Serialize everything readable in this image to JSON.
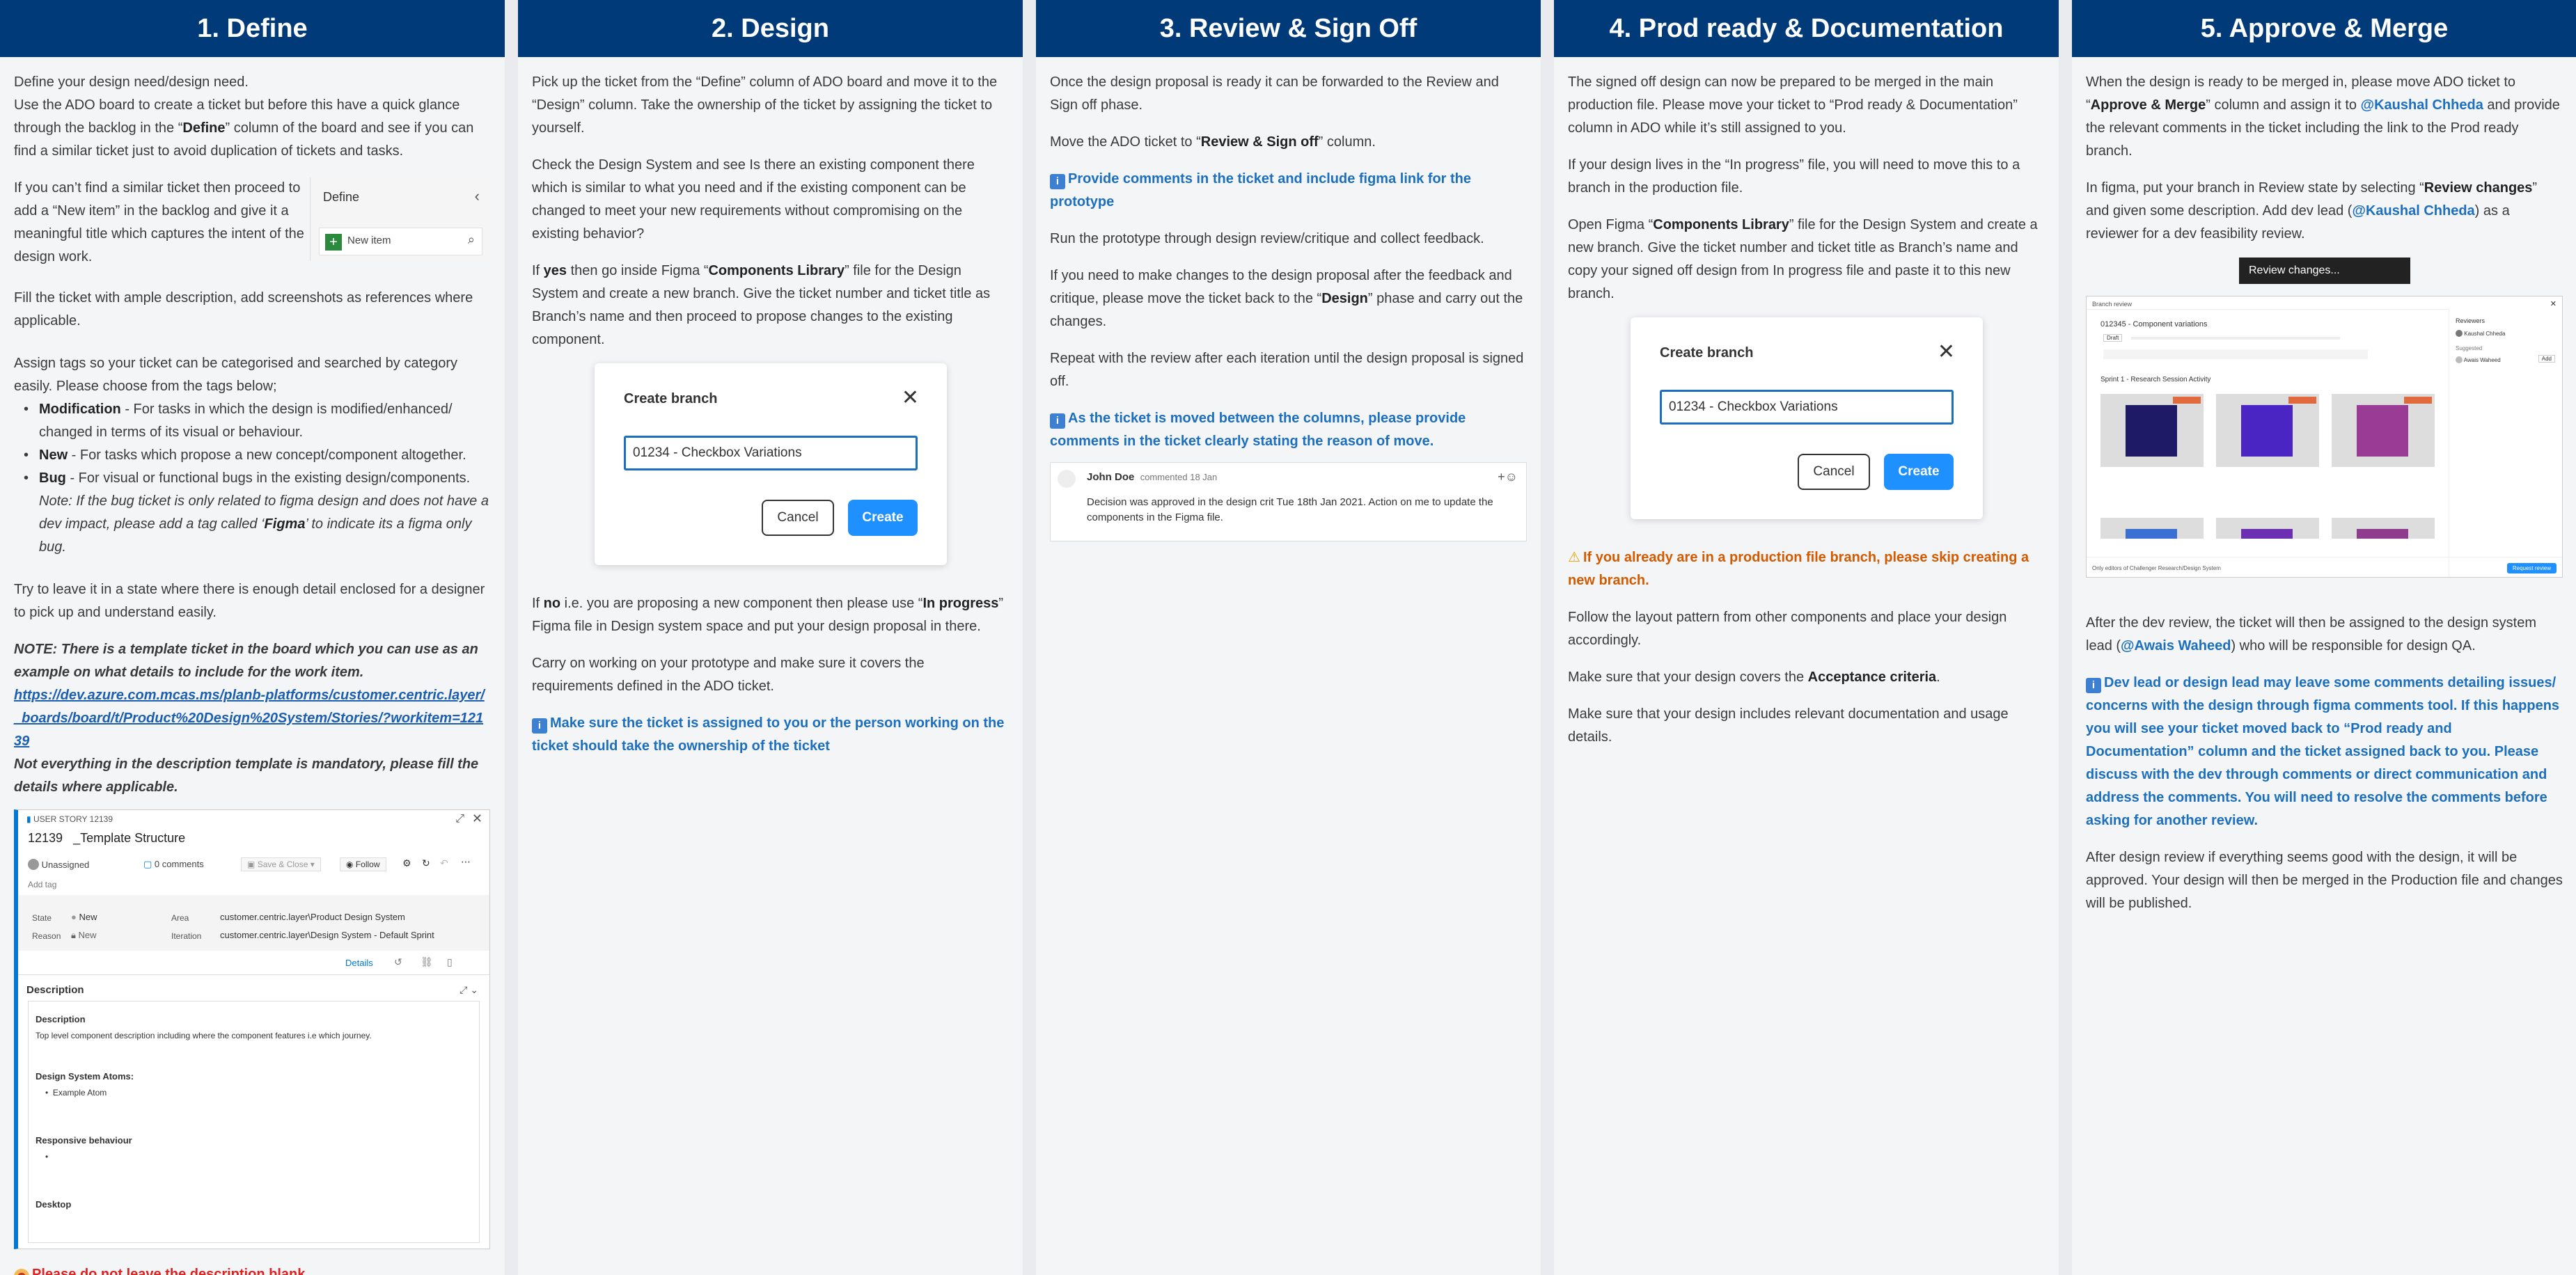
{
  "columns": [
    {
      "title": "1. Define"
    },
    {
      "title": "2. Design"
    },
    {
      "title": "3. Review & Sign Off"
    },
    {
      "title": "4. Prod ready & Documentation"
    },
    {
      "title": "5. Approve & Merge"
    }
  ],
  "define": {
    "p1": "Define your design need/design need.",
    "p2a": "Use the ADO board to create a ticket but before this have a quick glance through the backlog in the “",
    "p2b": "Define",
    "p2c": "” column of the board and see if you can find a similar ticket just to avoid duplication of tickets and tasks.",
    "p3": "If you can’t find a similar ticket then proceed to add a “New item” in the backlog and give it a meaningful title which captures the intent of the design work.",
    "panel_title": "Define",
    "panel_new_item": "New item",
    "p4": "Fill the ticket with ample description, add screenshots as references where applicable.",
    "p5": "Assign tags so your ticket can be categorised and searched by category easily. Please choose from the tags below;",
    "tag1_name": "Modification",
    "tag1_desc": " - For tasks in which the design is modified/enhanced/ changed in terms of its visual or behaviour.",
    "tag2_name": "New",
    "tag2_desc": " - For tasks which propose a new concept/component altogether.",
    "tag3_name": "Bug",
    "tag3_desc": " - For visual or functional bugs in the existing design/components.",
    "bug_note_a": "Note: If the bug ticket is only related to figma design and does not have a dev impact, please add a tag called ‘",
    "bug_note_b": "Figma",
    "bug_note_c": "’ to indicate its a figma only bug.",
    "p6": "Try to leave it in a state where there is enough detail enclosed for a designer to pick up and understand easily.",
    "note": "NOTE: There is a template ticket in the board which you can use as an example on what details to include for the work item.",
    "link": "https://dev.azure.com.mcas.ms/planb-platforms/customer.centric.layer/_boards/board/t/Product%20Design%20System/Stories/?workitem=12139",
    "note2": "Not everything in the description template is mandatory, please fill the details where applicable.",
    "warning": "Please do not leave the description blank."
  },
  "story": {
    "type_label": "USER STORY 12139",
    "id": "12139",
    "title": "_Template Structure",
    "assignee": "Unassigned",
    "comments": "0 comments",
    "save_close": "Save & Close",
    "follow": "Follow",
    "add_tag": "Add tag",
    "state_label": "State",
    "state_value": "New",
    "reason_label": "Reason",
    "reason_value": "New",
    "area_label": "Area",
    "area_value": "customer.centric.layer\\Product Design System",
    "iteration_label": "Iteration",
    "iteration_value": "customer.centric.layer\\Design System - Default Sprint",
    "details_tab": "Details",
    "desc_heading": "Description",
    "d_sub1": "Description",
    "d_text1": "Top level component description including where the component features i.e which journey.",
    "d_sub2": "Design System Atoms:",
    "d_item2": "Example Atom",
    "d_sub3": "Responsive behaviour",
    "d_sub4": "Desktop"
  },
  "design": {
    "p1": "Pick up the ticket from the “Define” column of ADO board and move it to the “Design” column. Take the ownership of the ticket by assigning the ticket to yourself.",
    "p2": "Check the Design System and see Is there an existing component there which is similar to what you need and if the existing component can be changed to meet your new requirements without compromising on the existing behavior?",
    "p3a": "If ",
    "p3b": "yes",
    "p3c": " then go inside Figma “",
    "p3d": "Components Library",
    "p3e": "” file for the Design System and create a new branch. Give the ticket number and ticket title as Branch’s name and then proceed to propose changes to the existing component.",
    "p4a": "If ",
    "p4b": "no",
    "p4c": " i.e. you are proposing a new component then please use “",
    "p4d": "In progress",
    "p4e": "” Figma file in Design system space and put your design proposal in there.",
    "p5": "Carry on working on your prototype and make sure it covers the requirements defined in the ADO ticket.",
    "callout": "Make sure the ticket is assigned to you or the person working on the ticket should take the ownership of the ticket"
  },
  "dialog": {
    "title": "Create branch",
    "input_value": "01234 - Checkbox Variations",
    "cancel": "Cancel",
    "create": "Create"
  },
  "review": {
    "p1": "Once the design proposal is ready it can be forwarded to the Review and Sign off phase.",
    "p2a": "Move the ADO ticket to “",
    "p2b": "Review & Sign off",
    "p2c": "” column.",
    "callout1": "Provide comments in the ticket and include figma link for the prototype",
    "p3": "Run the prototype through design review/critique and collect feedback.",
    "p4a": "If you need to make changes to the design proposal after the feedback and critique, please move the ticket back to the “",
    "p4b": "Design",
    "p4c": "” phase and carry out the changes.",
    "p5": "Repeat with the review after each iteration until the design proposal is signed off.",
    "callout2": "As the ticket is moved between the columns, please provide comments in the ticket clearly stating the reason of move.",
    "comment_author": "John Doe",
    "comment_meta": "commented 18 Jan",
    "comment_text": "Decision was approved in the design crit Tue 18th Jan 2021. Action on me to update the components in the Figma file."
  },
  "prod": {
    "p1": "The signed off design can now be prepared to be merged in the main production file. Please move your ticket to “Prod ready & Documentation” column in ADO while it’s still assigned to you.",
    "p2": "If your design lives in the “In progress” file, you will need to move this to a branch in the production file.",
    "p3a": "Open Figma “",
    "p3b": "Components Library",
    "p3c": "” file for the Design System and create a new branch. Give the ticket number and ticket title as Branch’s name and copy your signed off design from In progress file and paste it to this new branch.",
    "warning": "If you already are in a production file branch, please skip creating a new branch.",
    "p4": "Follow the layout pattern from other components and place your design accordingly.",
    "p5a": "Make sure that your design covers the ",
    "p5b": "Acceptance criteria",
    "p5c": ".",
    "p6": "Make sure that your design includes relevant documentation and usage details."
  },
  "merge": {
    "p1a": "When the design is ready to be merged in, please move ADO ticket to “",
    "p1b": "Approve & Merge",
    "p1c": "” column and assign it to ",
    "p1d": "@Kaushal Chheda",
    "p1e": " and provide the relevant comments in the ticket including the link to the Prod ready branch.",
    "p2a": "In figma, put your branch in Review state by selecting “",
    "p2b": "Review changes",
    "p2c": "” and given some description. Add dev lead (",
    "p2d": "@Kaushal Chheda",
    "p2e": ") as a reviewer for a dev feasibility review.",
    "review_btn": "Review changes...",
    "br_header": "Branch review",
    "br_title": "012345 - Component variations",
    "br_draft": "Draft",
    "br_sprint": "Sprint 1 - Research Session Activity",
    "br_reviewers": "Reviewers",
    "br_r1": "Kaushal Chheda",
    "br_suggested": "Suggested",
    "br_r2": "Awais Waheed",
    "br_add": "Add",
    "br_footer": "Only editors of Challenger Research/Design System",
    "br_request": "Request review",
    "p3a": "After the dev review, the ticket will then be assigned to the design system lead (",
    "p3b": "@Awais Waheed",
    "p3c": ") who will be responsible for design QA.",
    "callout": "Dev lead or design lead may leave some comments detailing issues/ concerns with the design through figma comments tool. If this happens you will see your ticket moved back to “Prod ready and Documentation” column and the ticket assigned back to you. Please discuss with the dev through comments or direct communication and address the comments. You will need to resolve the comments before asking for another review.",
    "p4": "After design review if everything seems good with the design, it will be approved. Your design will then be merged in the Production file and changes will be published."
  },
  "colors": {
    "header_bg": "#003a78",
    "accent_blue": "#1c6fbf",
    "button_blue": "#1e90ff",
    "warning_orange": "#d45a00",
    "error_red": "#dd2222"
  }
}
